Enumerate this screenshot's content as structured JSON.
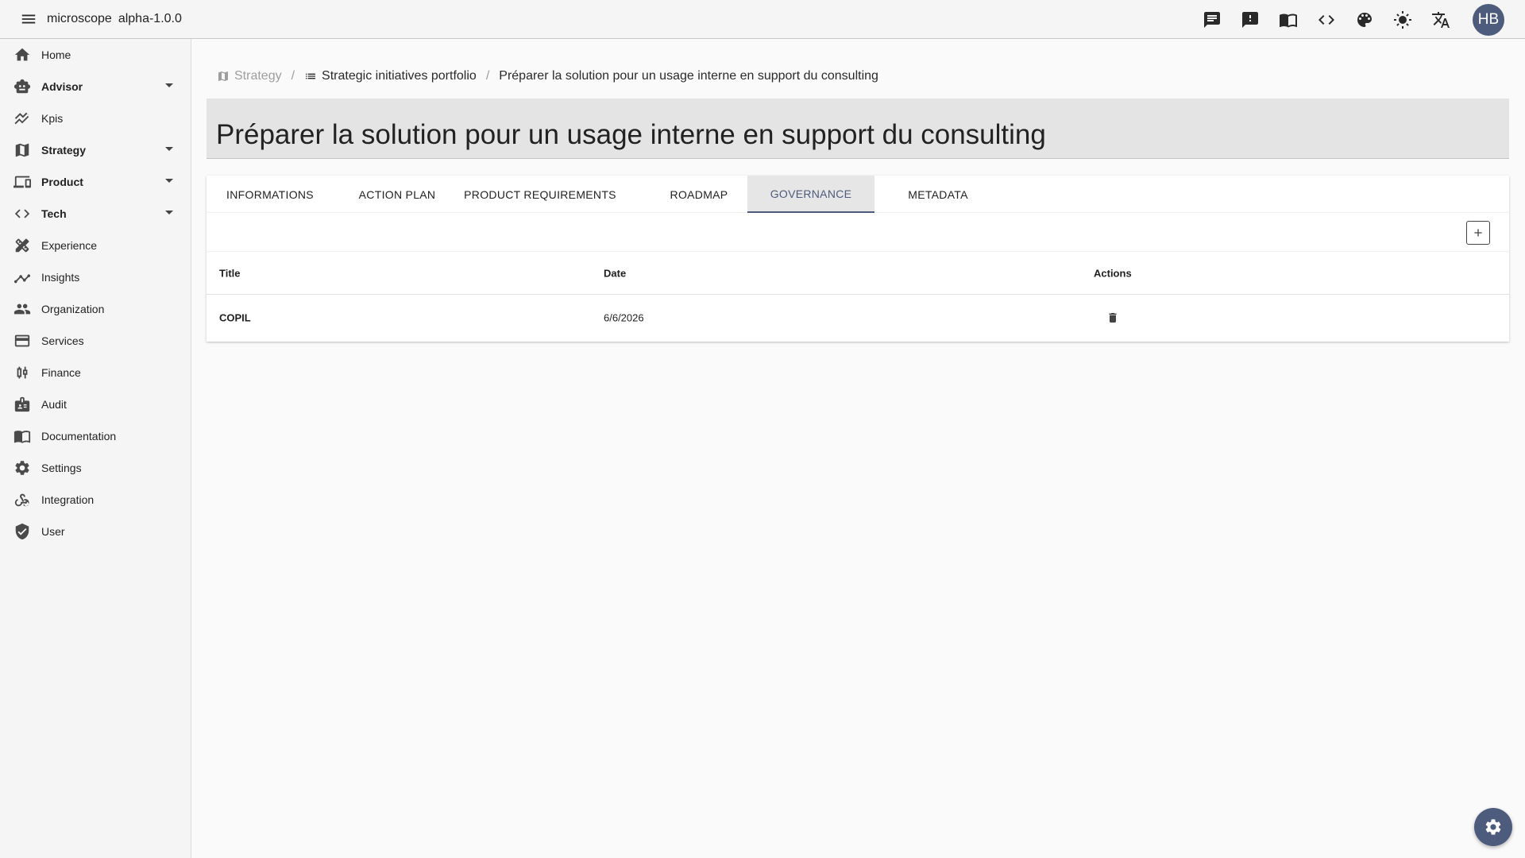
{
  "app": {
    "name": "microscope",
    "version": "alpha-1.0.0"
  },
  "topbar": {
    "icons": [
      "chat-icon",
      "feedback-icon",
      "docs-book-icon",
      "code-icon",
      "palette-icon",
      "brightness-icon",
      "translate-icon"
    ],
    "avatar_initials": "HB"
  },
  "sidebar": {
    "items": [
      {
        "label": "Home",
        "icon": "home-icon",
        "expandable": false,
        "bold": false
      },
      {
        "label": "Advisor",
        "icon": "robot-icon",
        "expandable": true,
        "bold": true
      },
      {
        "label": "Kpis",
        "icon": "kpi-chart-icon",
        "expandable": false,
        "bold": false
      },
      {
        "label": "Strategy",
        "icon": "map-icon",
        "expandable": true,
        "bold": true
      },
      {
        "label": "Product",
        "icon": "devices-icon",
        "expandable": true,
        "bold": true
      },
      {
        "label": "Tech",
        "icon": "code-icon",
        "expandable": true,
        "bold": true
      },
      {
        "label": "Experience",
        "icon": "design-tools-icon",
        "expandable": false,
        "bold": false
      },
      {
        "label": "Insights",
        "icon": "insights-icon",
        "expandable": false,
        "bold": false
      },
      {
        "label": "Organization",
        "icon": "people-icon",
        "expandable": false,
        "bold": false
      },
      {
        "label": "Services",
        "icon": "card-icon",
        "expandable": false,
        "bold": false
      },
      {
        "label": "Finance",
        "icon": "candlestick-icon",
        "expandable": false,
        "bold": false
      },
      {
        "label": "Audit",
        "icon": "audit-badge-icon",
        "expandable": false,
        "bold": false
      },
      {
        "label": "Documentation",
        "icon": "book-icon",
        "expandable": false,
        "bold": false
      },
      {
        "label": "Settings",
        "icon": "gear-icon",
        "expandable": false,
        "bold": false
      },
      {
        "label": "Integration",
        "icon": "webhook-icon",
        "expandable": false,
        "bold": false
      },
      {
        "label": "User",
        "icon": "shield-check-icon",
        "expandable": false,
        "bold": false
      }
    ]
  },
  "breadcrumb": {
    "items": [
      {
        "label": "Strategy",
        "icon": "map-icon"
      },
      {
        "label": "Strategic initiatives portfolio",
        "icon": "list-icon"
      },
      {
        "label": "Préparer la solution pour un usage interne en support du consulting"
      }
    ],
    "separator": "/"
  },
  "page": {
    "title": "Préparer la solution pour un usage interne en support du consulting"
  },
  "tabs": [
    {
      "label": "INFORMATIONS",
      "active": false
    },
    {
      "label": "ACTION PLAN",
      "active": false
    },
    {
      "label": "PRODUCT REQUIREMENTS",
      "active": false
    },
    {
      "label": "ROADMAP",
      "active": false
    },
    {
      "label": "GOVERNANCE",
      "active": true
    },
    {
      "label": "METADATA",
      "active": false
    }
  ],
  "table": {
    "columns": [
      "Title",
      "Date",
      "Actions"
    ],
    "rows": [
      {
        "title": "COPIL",
        "date": "6/6/2026"
      }
    ]
  },
  "colors": {
    "accent": "#4d5b7c",
    "title_band": "#e4e4e4",
    "sidebar_bg": "#f5f5f5"
  }
}
